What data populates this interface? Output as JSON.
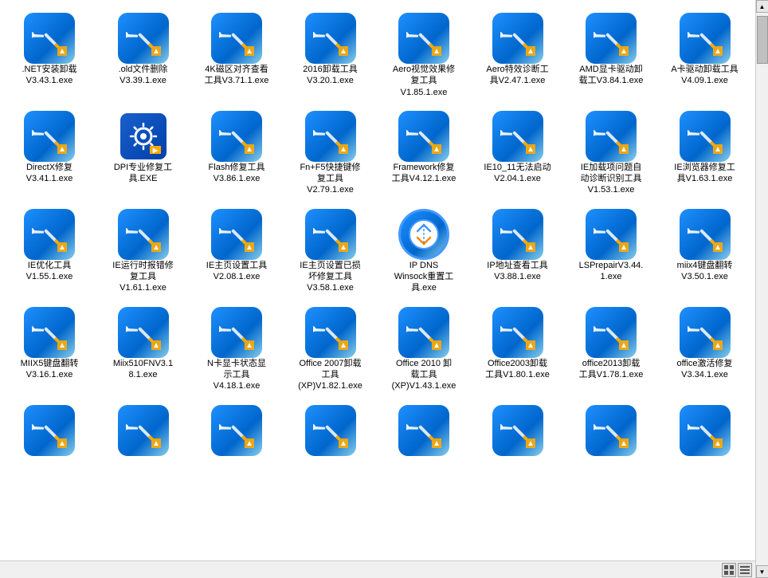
{
  "icons": [
    {
      "id": 1,
      "label": ".NET安装卸载\nV3.43.1.exe",
      "type": "blue"
    },
    {
      "id": 2,
      "label": ".old文件删除\nV3.39.1.exe",
      "type": "blue"
    },
    {
      "id": 3,
      "label": "4K磁区对齐查看\n工具V3.71.1.exe",
      "type": "blue"
    },
    {
      "id": 4,
      "label": "2016卸载工具\nV3.20.1.exe",
      "type": "blue"
    },
    {
      "id": 5,
      "label": "Aero视觉效果修\n复工具\nV1.85.1.exe",
      "type": "blue"
    },
    {
      "id": 6,
      "label": "Aero特效诊断工\n具V2.47.1.exe",
      "type": "blue"
    },
    {
      "id": 7,
      "label": "AMD显卡驱动卸\n载工V3.84.1.exe",
      "type": "blue"
    },
    {
      "id": 8,
      "label": "A卡驱动卸载工具\nV4.09.1.exe",
      "type": "blue"
    },
    {
      "id": 9,
      "label": "DirectX修复\nV3.41.1.exe",
      "type": "blue"
    },
    {
      "id": 10,
      "label": "DPI专业修复工\n具.EXE",
      "type": "dpi"
    },
    {
      "id": 11,
      "label": "Flash修复工具\nV3.86.1.exe",
      "type": "blue"
    },
    {
      "id": 12,
      "label": "Fn+F5快捷键修\n复工具\nV2.79.1.exe",
      "type": "blue"
    },
    {
      "id": 13,
      "label": "Framework修复\n工具V4.12.1.exe",
      "type": "blue"
    },
    {
      "id": 14,
      "label": "IE10_11无法启动\nV2.04.1.exe",
      "type": "blue"
    },
    {
      "id": 15,
      "label": "IE加载项问题自\n动诊断识别工具\nV1.53.1.exe",
      "type": "blue"
    },
    {
      "id": 16,
      "label": "IE浏览器修复工\n具V1.63.1.exe",
      "type": "blue"
    },
    {
      "id": 17,
      "label": "IE优化工具\nV1.55.1.exe",
      "type": "blue"
    },
    {
      "id": 18,
      "label": "IE运行时报错修\n复工具\nV1.61.1.exe",
      "type": "blue"
    },
    {
      "id": 19,
      "label": "IE主页设置工具\nV2.08.1.exe",
      "type": "blue"
    },
    {
      "id": 20,
      "label": "IE主页设置已损\n坏修复工具\nV3.58.1.exe",
      "type": "blue"
    },
    {
      "id": 21,
      "label": "IP DNS\nWinsock重置工\n具.exe",
      "type": "circle"
    },
    {
      "id": 22,
      "label": "IP地址查看工具\nV3.88.1.exe",
      "type": "blue"
    },
    {
      "id": 23,
      "label": "LSPrepairV3.44.\n1.exe",
      "type": "blue"
    },
    {
      "id": 24,
      "label": "miix4键盘翻转\nV3.50.1.exe",
      "type": "blue"
    },
    {
      "id": 25,
      "label": "MIIX5键盘翻转\nV3.16.1.exe",
      "type": "blue"
    },
    {
      "id": 26,
      "label": "Miix510FNV3.1\n8.1.exe",
      "type": "blue"
    },
    {
      "id": 27,
      "label": "N卡显卡状态显\n示工具\nV4.18.1.exe",
      "type": "blue"
    },
    {
      "id": 28,
      "label": "Office 2007卸载\n工具\n(XP)V1.82.1.exe",
      "type": "blue"
    },
    {
      "id": 29,
      "label": "Office 2010 卸\n载工具\n(XP)V1.43.1.exe",
      "type": "blue"
    },
    {
      "id": 30,
      "label": "Office2003卸载\n工具V1.80.1.exe",
      "type": "blue"
    },
    {
      "id": 31,
      "label": "office2013卸载\n工具V1.78.1.exe",
      "type": "blue"
    },
    {
      "id": 32,
      "label": "office激活修复\nV3.34.1.exe",
      "type": "blue"
    },
    {
      "id": 33,
      "label": "",
      "type": "blue"
    },
    {
      "id": 34,
      "label": "",
      "type": "blue"
    },
    {
      "id": 35,
      "label": "",
      "type": "blue"
    },
    {
      "id": 36,
      "label": "",
      "type": "blue"
    },
    {
      "id": 37,
      "label": "",
      "type": "blue"
    },
    {
      "id": 38,
      "label": "",
      "type": "blue"
    },
    {
      "id": 39,
      "label": "",
      "type": "blue"
    },
    {
      "id": 40,
      "label": "",
      "type": "blue"
    }
  ],
  "statusbar": {
    "view_icon1": "grid",
    "view_icon2": "list"
  }
}
